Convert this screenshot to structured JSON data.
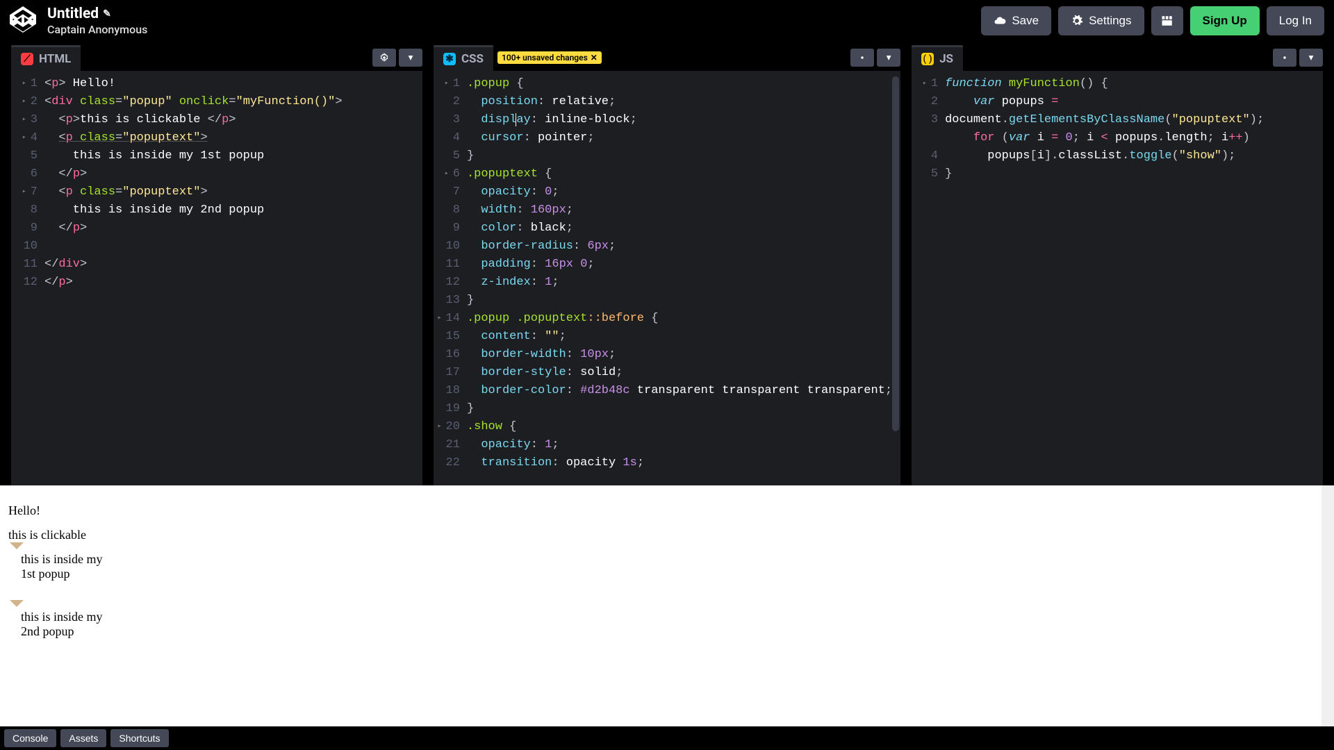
{
  "header": {
    "title": "Untitled",
    "author": "Captain Anonymous",
    "buttons": {
      "save": "Save",
      "settings": "Settings",
      "signup": "Sign Up",
      "login": "Log In"
    }
  },
  "panes": {
    "html": {
      "label": "HTML",
      "lines": [
        "1",
        "2",
        "3",
        "4",
        "5",
        "6",
        "7",
        "8",
        "9",
        "10",
        "11",
        "12"
      ]
    },
    "css": {
      "label": "CSS",
      "unsaved_badge": "100+ unsaved changes",
      "lines": [
        "1",
        "2",
        "3",
        "4",
        "5",
        "6",
        "7",
        "8",
        "9",
        "10",
        "11",
        "12",
        "13",
        "14",
        "15",
        "16",
        "17",
        "18",
        "19",
        "20",
        "21",
        "22"
      ]
    },
    "js": {
      "label": "JS",
      "lines": [
        "1",
        "2",
        "3",
        "4",
        "5"
      ]
    }
  },
  "html_code": {
    "l1_text": " Hello!",
    "l3_text": "this is clickable ",
    "l5_text": "    this is inside my 1st popup",
    "l8_text": "    this is inside my 2nd popup",
    "class_popup": "popup",
    "onclick_val": "myFunction()",
    "class_popuptext": "popuptext"
  },
  "css_code": {
    "sel_popup": ".popup",
    "sel_popuptext": ".popuptext",
    "sel_before": ".popup .popuptext",
    "pseudo_before": "::before",
    "sel_show": ".show",
    "props": {
      "position": "position",
      "display": "display",
      "cursor": "cursor",
      "opacity": "opacity",
      "width": "width",
      "color": "color",
      "border_radius": "border-radius",
      "padding": "padding",
      "z_index": "z-index",
      "content": "content",
      "border_width": "border-width",
      "border_style": "border-style",
      "border_color": "border-color",
      "transition": "transition"
    },
    "vals": {
      "relative": "relative",
      "inline_block": "inline-block",
      "pointer": "pointer",
      "zero": "0",
      "w160": "160px",
      "black": "black",
      "r6": "6px",
      "pad": "16px",
      "pad0": "0",
      "z1": "1",
      "empty": "\"\"",
      "bw10": "10px",
      "solid": "solid",
      "tan": "#d2b48c",
      "transparent": "transparent",
      "one": "1",
      "opacity_word": "opacity",
      "one_s": "1s"
    }
  },
  "js_code": {
    "kw_function": "function",
    "fn_name": "myFunction",
    "kw_var": "var",
    "id_popups": "popups",
    "id_document": "document",
    "m_gebcn": "getElementsByClassName",
    "str_popuptext": "\"popuptext\"",
    "kw_for": "for",
    "id_i": "i",
    "num_0": "0",
    "id_length": "length",
    "m_classList": "classList",
    "m_toggle": "toggle",
    "str_show": "\"show\""
  },
  "result": {
    "hello": "Hello!",
    "clickable": "this is clickable",
    "popup1": "this is inside my 1st popup",
    "popup2": "this is inside my 2nd popup"
  },
  "footer": {
    "console": "Console",
    "assets": "Assets",
    "shortcuts": "Shortcuts"
  }
}
